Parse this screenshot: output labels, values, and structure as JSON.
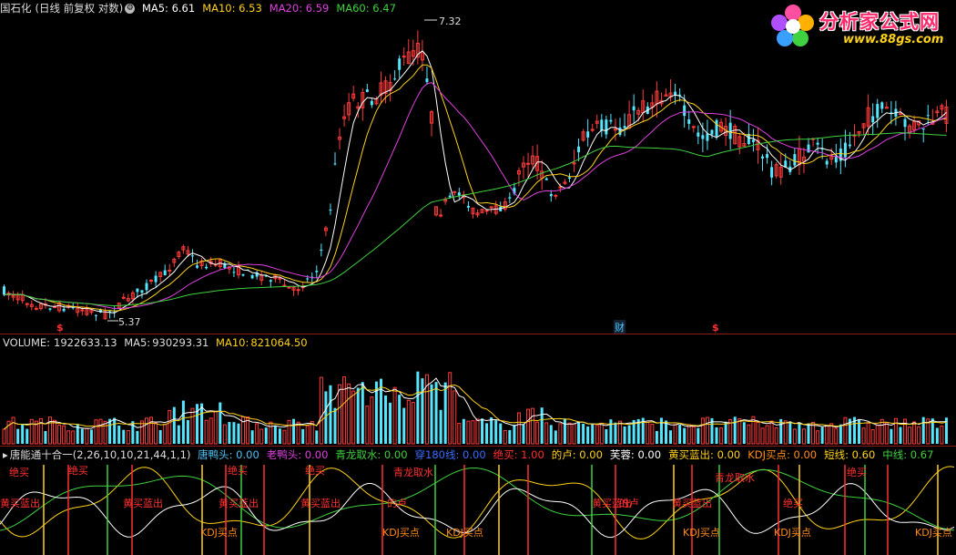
{
  "price": {
    "stock_name": "国石化",
    "period_info": "(日线 前复权 对数)",
    "settings_icon": "⚙",
    "ma": [
      {
        "label": "MA5:",
        "value": "6.61",
        "color": "#ffffff"
      },
      {
        "label": "MA10:",
        "value": "6.53",
        "color": "#ffd21a"
      },
      {
        "label": "MA20:",
        "value": "6.59",
        "color": "#e040e0"
      },
      {
        "label": "MA60:",
        "value": "6.47",
        "color": "#3fd13f"
      }
    ],
    "high_label": "7.32",
    "low_label": "5.37",
    "markers": [
      {
        "text": "$",
        "color": "#ff3030"
      },
      {
        "text": "财",
        "color": "#4fc3f7"
      },
      {
        "text": "$",
        "color": "#ff3030"
      }
    ]
  },
  "volume": {
    "label": "VOLUME:",
    "value": "1922633.13",
    "ma5_label": "MA5:",
    "ma5_value": "930293.31",
    "ma10_label": "MA10:",
    "ma10_value": "821064.50"
  },
  "indicator": {
    "name": "唐能通十合一",
    "params": "(2,26,10,10,21,44,1,1)",
    "items": [
      {
        "label": "唐鸭头:",
        "value": "0.00",
        "color": "#4fc3f7"
      },
      {
        "label": "老鸭头:",
        "value": "0.00",
        "color": "#e040e0"
      },
      {
        "label": "青龙取水:",
        "value": "0.00",
        "color": "#3fd13f"
      },
      {
        "label": "穿180线:",
        "value": "0.00",
        "color": "#3a6cff"
      },
      {
        "label": "绝买:",
        "value": "1.00",
        "color": "#ff3030"
      },
      {
        "label": "的卢:",
        "value": "0.00",
        "color": "#ffd21a"
      },
      {
        "label": "芙蓉:",
        "value": "0.00",
        "color": "#ffffff"
      },
      {
        "label": "黄买蓝出:",
        "value": "0.00",
        "color": "#ffd21a"
      },
      {
        "label": "KDJ买点:",
        "value": "0.00",
        "color": "#ff8c1a"
      },
      {
        "label": "短线:",
        "value": "0.60",
        "color": "#ffd21a"
      },
      {
        "label": "中线:",
        "value": "0.67",
        "color": "#3fd13f"
      }
    ],
    "signal_labels": [
      "绝买",
      "青龙取水",
      "黄买蓝出",
      "KDJ买点",
      "的卢"
    ]
  },
  "logo": {
    "title": "分析家公式网",
    "url": "www.88gs.com"
  }
}
